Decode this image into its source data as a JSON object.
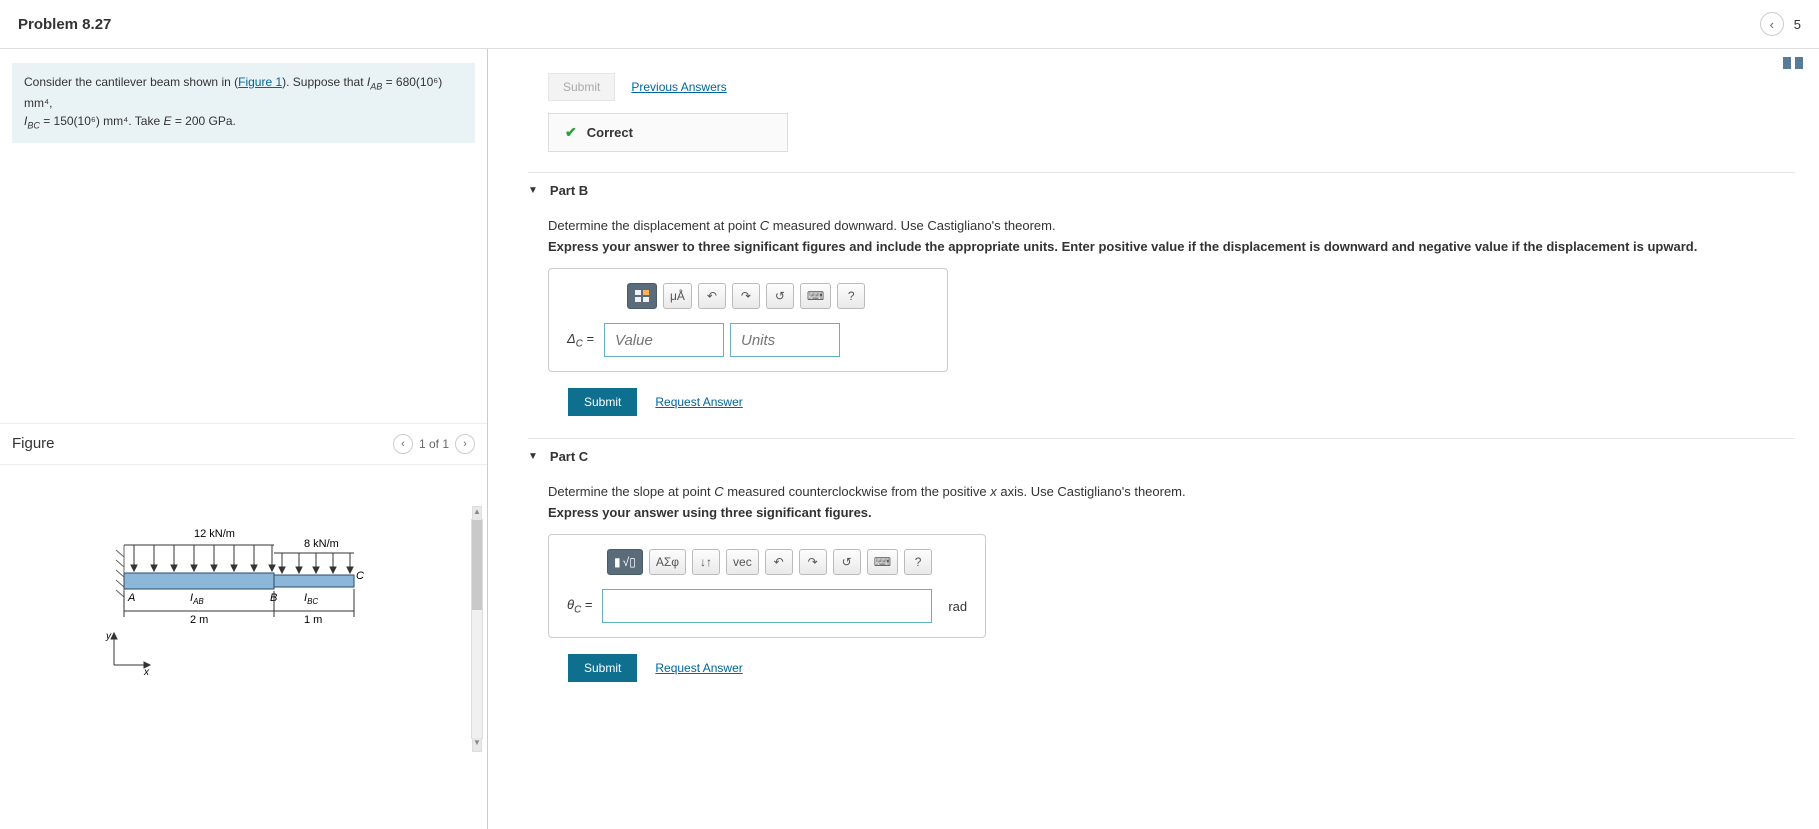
{
  "header": {
    "title": "Problem 8.27",
    "right_count": "5"
  },
  "problem": {
    "prefix": "Consider the cantilever beam shown in (",
    "figlink": "Figure 1",
    "suffix": "). Suppose that ",
    "iab_sym": "I_{AB}",
    "iab_val": " = 680(10⁶) mm⁴",
    "ibc_sym": "I_{BC}",
    "ibc_val": " = 150(10⁶) mm⁴",
    "take": ". Take ",
    "e_sym": "E",
    "e_val": " = 200 GPa."
  },
  "figure": {
    "title": "Figure",
    "page": "1 of 1",
    "load1": "12 kN/m",
    "load2": "8 kN/m",
    "ptA": "A",
    "ptB": "B",
    "ptC": "C",
    "iab": "I",
    "iab_sub": "AB",
    "ibc": "I",
    "ibc_sub": "BC",
    "len1": "2 m",
    "len2": "1 m",
    "axY": "y",
    "axX": "x"
  },
  "partA": {
    "submit": "Submit",
    "prev": "Previous Answers",
    "correct": "Correct"
  },
  "partB": {
    "title": "Part B",
    "prompt_pre": "Determine the displacement at point ",
    "prompt_c": "C",
    "prompt_post": " measured downward. Use Castigliano's theorem.",
    "instr": "Express your answer to three significant figures and include the appropriate units. Enter positive value if the displacement is downward and negative value if the displacement is upward.",
    "tool_uA": "μÅ",
    "tool_help": "?",
    "var": "Δ_C =",
    "val_ph": "Value",
    "unit_ph": "Units",
    "submit": "Submit",
    "request": "Request Answer"
  },
  "partC": {
    "title": "Part C",
    "prompt_pre": "Determine the slope at point ",
    "prompt_c": "C",
    "prompt_mid": " measured counterclockwise from the positive ",
    "prompt_x": "x",
    "prompt_post": " axis. Use Castigliano's theorem.",
    "instr": "Express your answer using three significant figures.",
    "tool_sigma": "ΑΣφ",
    "tool_arrows": "↓↑",
    "tool_vec": "vec",
    "tool_help": "?",
    "var": "θ_C =",
    "unit": "rad",
    "submit": "Submit",
    "request": "Request Answer"
  }
}
